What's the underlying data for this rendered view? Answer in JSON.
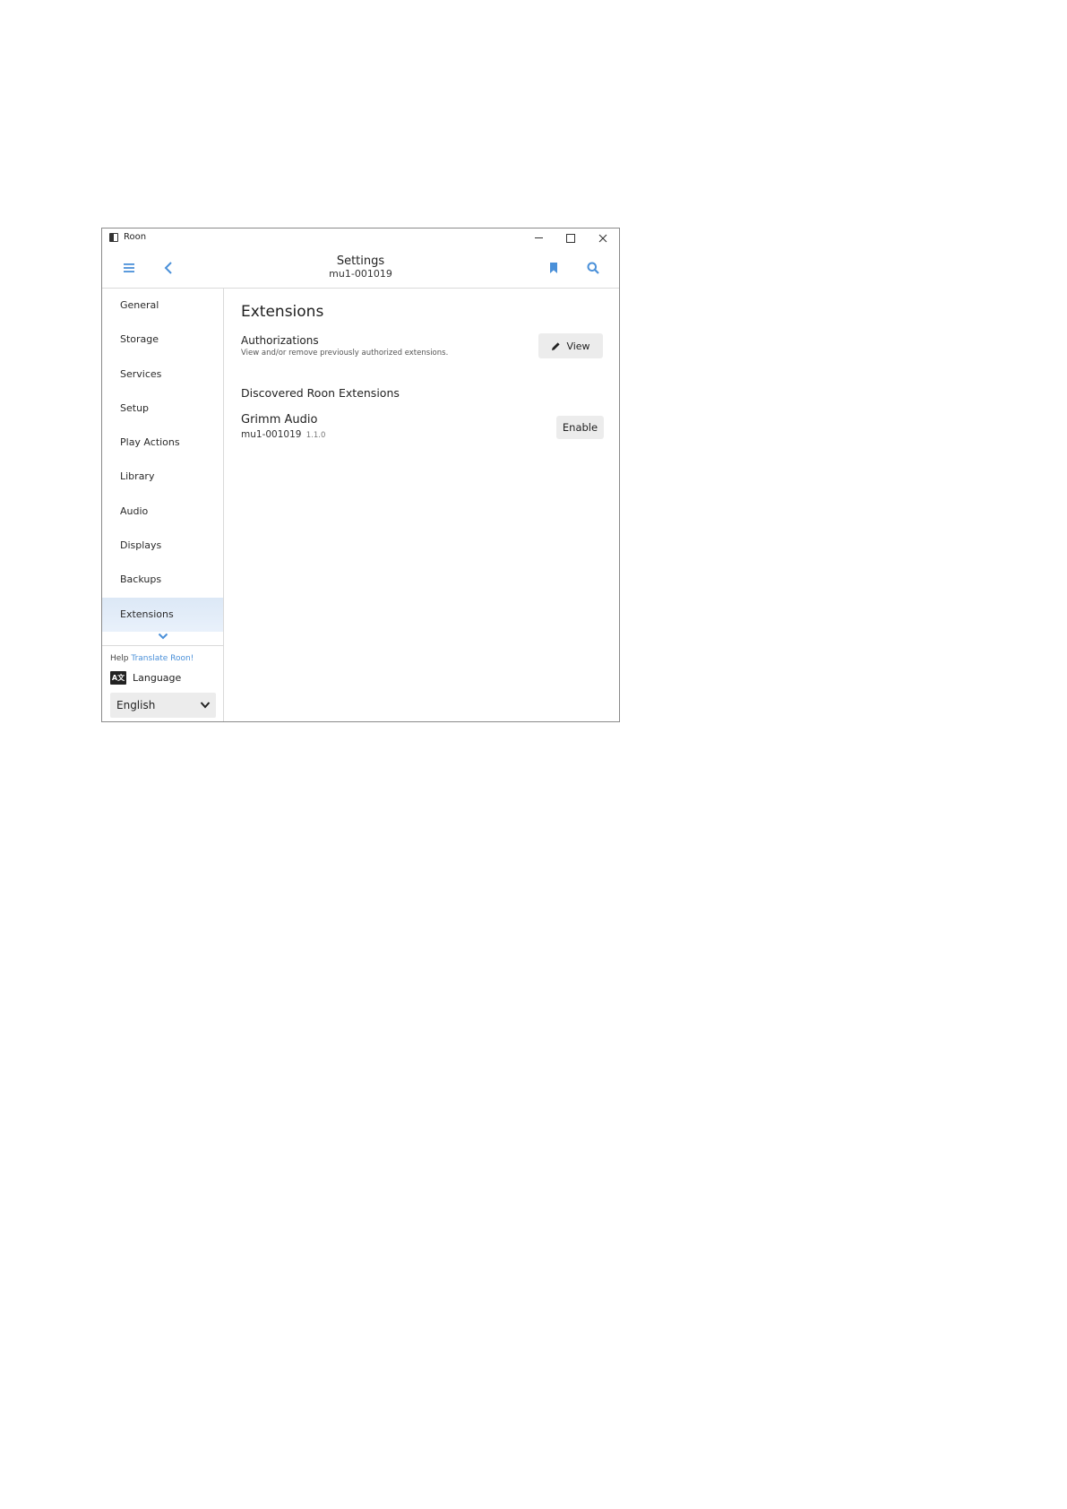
{
  "window": {
    "app_title": "Roon",
    "app_icon": "roon-app-icon",
    "controls": [
      "minimize-icon",
      "maximize-icon",
      "close-icon"
    ]
  },
  "header": {
    "title": "Settings",
    "subtitle": "mu1-001019",
    "left_icons": [
      "hamburger-menu-icon",
      "back-chevron-icon"
    ],
    "right_icons": [
      "bookmark-icon",
      "search-icon"
    ],
    "accent_color": "#4a90d9"
  },
  "sidebar": {
    "items": [
      {
        "label": "General"
      },
      {
        "label": "Storage"
      },
      {
        "label": "Services"
      },
      {
        "label": "Setup"
      },
      {
        "label": "Play Actions"
      },
      {
        "label": "Library"
      },
      {
        "label": "Audio"
      },
      {
        "label": "Displays"
      },
      {
        "label": "Backups"
      },
      {
        "label": "Extensions",
        "active": true
      }
    ],
    "help_prefix": "Help",
    "help_link": "Translate Roon!",
    "language_label": "Language",
    "language_icon_text": "A文",
    "language_selected": "English",
    "active_bg": "#dce8f6"
  },
  "main": {
    "title": "Extensions",
    "authorizations": {
      "title": "Authorizations",
      "description": "View and/or remove previously authorized extensions.",
      "button_label": "View"
    },
    "discovered_title": "Discovered Roon Extensions",
    "extensions": [
      {
        "name": "Grimm Audio",
        "host": "mu1-001019",
        "version": "1.1.0",
        "button_label": "Enable"
      }
    ]
  }
}
